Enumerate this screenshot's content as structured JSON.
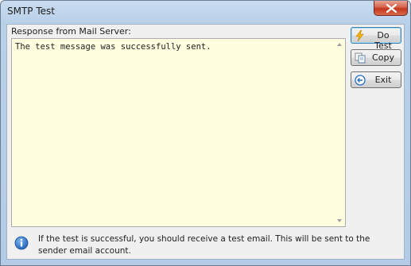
{
  "window": {
    "title": "SMTP Test"
  },
  "titlebar": {
    "close_icon": "close-icon"
  },
  "response": {
    "label": "Response from Mail Server:",
    "text": "The test message was successfully sent."
  },
  "buttons": {
    "do_test": {
      "label": "Do Test",
      "icon": "lightning-icon"
    },
    "copy": {
      "label": "Copy",
      "icon": "copy-icon"
    },
    "exit": {
      "label": "Exit",
      "icon": "exit-arrow-icon"
    }
  },
  "info": {
    "icon": "info-icon",
    "text": "If the test is successful, you should receive a test email.  This will be sent to the sender email account."
  },
  "colors": {
    "response_background": "#ffffe0",
    "close_button": "#c2371f",
    "titlebar": "#b9d0e9"
  }
}
